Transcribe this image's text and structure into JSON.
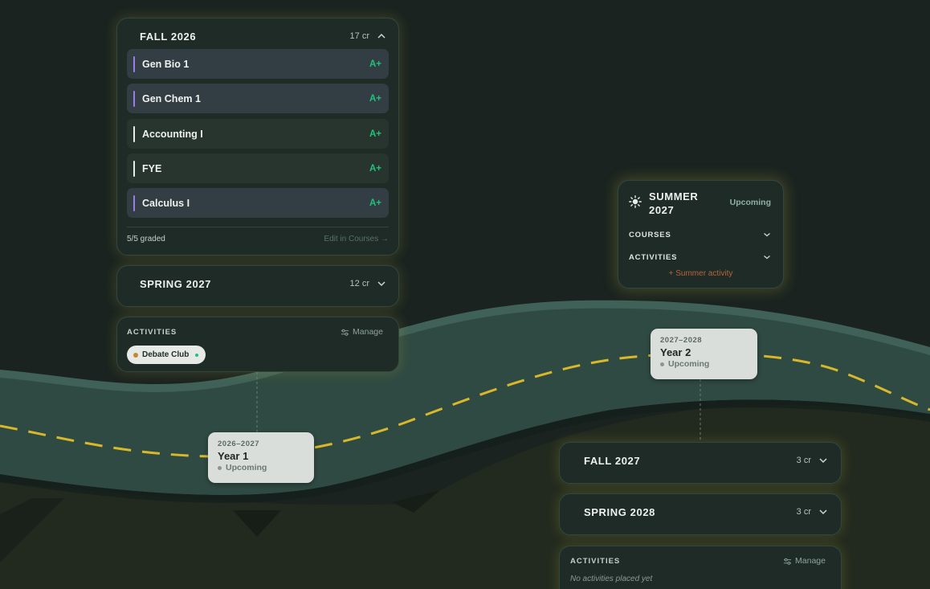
{
  "colors": {
    "background": "#1a2320",
    "road": "#2f4a42",
    "road_line": "#d8b82a",
    "grade": "#22c17a",
    "accent_purple": "#9a7ee6",
    "summer_add": "#b8643a",
    "upcoming": "#8fb0a6"
  },
  "fall_2026": {
    "title": "FALL 2026",
    "credits": "17 cr",
    "expanded": true,
    "courses": [
      {
        "name": "Gen Bio 1",
        "grade": "A+",
        "accent": "purple"
      },
      {
        "name": "Gen Chem 1",
        "grade": "A+",
        "accent": "purple"
      },
      {
        "name": "Accounting I",
        "grade": "A+",
        "accent": "white"
      },
      {
        "name": "FYE",
        "grade": "A+",
        "accent": "white"
      },
      {
        "name": "Calculus I",
        "grade": "A+",
        "accent": "purple"
      }
    ],
    "graded_text": "5/5 graded",
    "edit_link": "Edit in Courses →",
    "chevron_icon": "chevron-up-icon"
  },
  "spring_2027": {
    "title": "SPRING 2027",
    "credits": "12 cr",
    "chevron_icon": "chevron-down-icon"
  },
  "year1_activities": {
    "label": "ACTIVITIES",
    "manage_label": "Manage",
    "manage_icon": "sliders-icon",
    "chips": [
      {
        "label": "Debate Club"
      }
    ]
  },
  "year1": {
    "range": "2026–2027",
    "label": "Year 1",
    "status": "Upcoming"
  },
  "year2": {
    "range": "2027–2028",
    "label": "Year 2",
    "status": "Upcoming"
  },
  "summer_2027": {
    "icon": "sun-icon",
    "title_line1": "SUMMER",
    "title_line2": "2027",
    "status": "Upcoming",
    "courses_label": "COURSES",
    "activities_label": "ACTIVITIES",
    "add_activity": "+ Summer activity"
  },
  "fall_2027": {
    "title": "FALL 2027",
    "credits": "3 cr",
    "chevron_icon": "chevron-down-icon"
  },
  "spring_2028": {
    "title": "SPRING 2028",
    "credits": "3 cr",
    "chevron_icon": "chevron-down-icon"
  },
  "year2_activities": {
    "label": "ACTIVITIES",
    "manage_label": "Manage",
    "manage_icon": "sliders-icon",
    "empty_text": "No activities placed yet"
  }
}
